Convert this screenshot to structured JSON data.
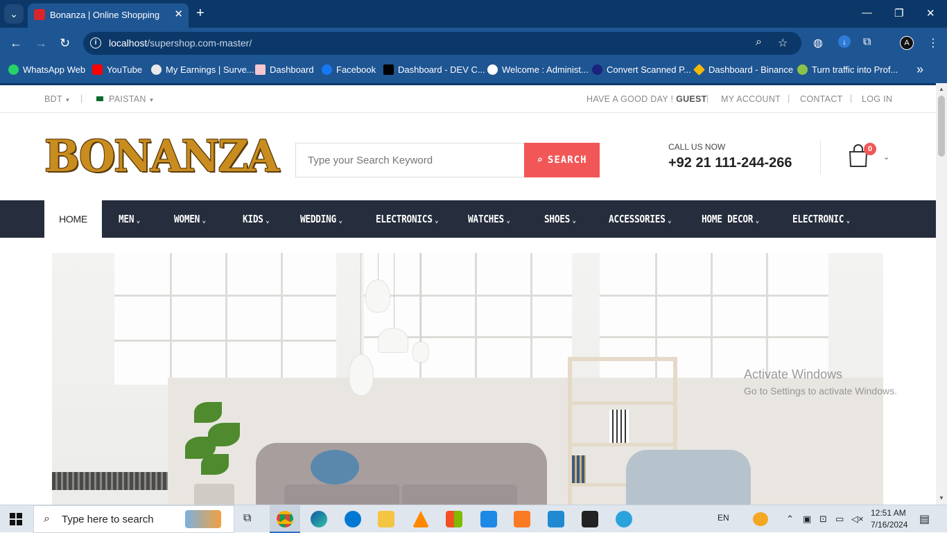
{
  "browser": {
    "tab_title": "Bonanza | Online Shopping",
    "url_host": "localhost",
    "url_path": "/supershop.com-master/",
    "bookmarks": [
      {
        "label": "WhatsApp Web",
        "color": "#25d366"
      },
      {
        "label": "YouTube",
        "color": "#ff0000"
      },
      {
        "label": "My Earnings | Surve...",
        "color": "#e9e9e9"
      },
      {
        "label": "Dashboard",
        "color": "#f4c6d0"
      },
      {
        "label": "Facebook",
        "color": "#1877f2"
      },
      {
        "label": "Dashboard - DEV C...",
        "color": "#000000"
      },
      {
        "label": "Welcome : Administ...",
        "color": "#ffffff"
      },
      {
        "label": "Convert Scanned P...",
        "color": "#1a237e"
      },
      {
        "label": "Dashboard - Binance",
        "color": "#f0b90b"
      },
      {
        "label": "Turn traffic into Prof...",
        "color": "#8bc34a"
      }
    ]
  },
  "topbar": {
    "currency": "BDT",
    "country": "PAISTAN",
    "greeting": "HAVE A GOOD DAY !",
    "guest": "GUEST",
    "my_account": "MY ACCOUNT",
    "contact": "CONTACT",
    "login": "LOG IN"
  },
  "header": {
    "logo_text": "BONANZA",
    "search_placeholder": "Type your Search Keyword",
    "search_button": "SEARCH",
    "call_label": "CALL US NOW",
    "call_number": "+92 21 111-244-266",
    "cart_count": "0"
  },
  "nav": {
    "items": [
      "HOME",
      "MEN",
      "WOMEN",
      "KIDS",
      "WEDDING",
      "ELECTRONICS",
      "WATCHES",
      "SHOES",
      "ACCESSORIES",
      "HOME DECOR",
      "ELECTRONIC"
    ]
  },
  "watermark": {
    "line1": "Activate Windows",
    "line2": "Go to Settings to activate Windows."
  },
  "taskbar": {
    "search_text": "Type here to search",
    "lang": "EN",
    "time": "12:51 AM",
    "date": "7/16/2024"
  },
  "colors": {
    "accent_red": "#f25757",
    "nav_dark": "#262d3d",
    "logo_gold": "#c98d1f",
    "chrome_blue": "#1e5593"
  }
}
